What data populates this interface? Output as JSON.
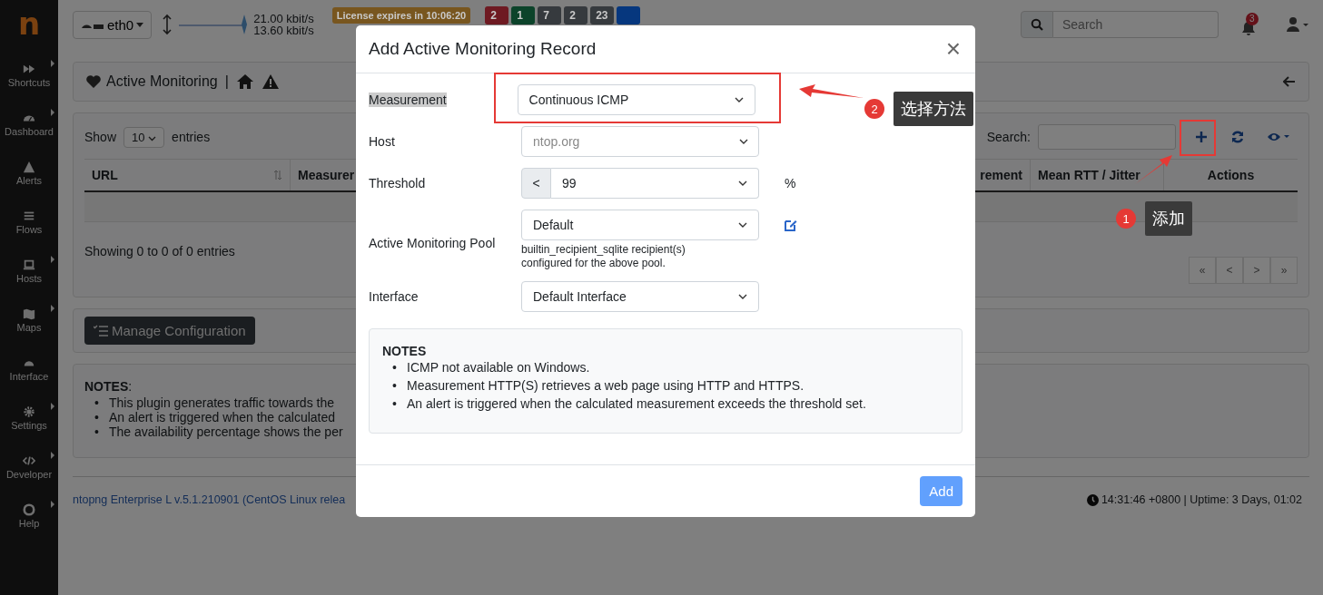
{
  "sidebar": {
    "logo": "n",
    "items": [
      {
        "label": "Shortcuts",
        "submenu": true
      },
      {
        "label": "Dashboard",
        "submenu": true
      },
      {
        "label": "Alerts",
        "submenu": false
      },
      {
        "label": "Flows",
        "submenu": false
      },
      {
        "label": "Hosts",
        "submenu": true
      },
      {
        "label": "Maps",
        "submenu": true
      },
      {
        "label": "Interface",
        "submenu": false
      },
      {
        "label": "Settings",
        "submenu": true
      },
      {
        "label": "Developer",
        "submenu": true
      },
      {
        "label": "Help",
        "submenu": true
      }
    ]
  },
  "topbar": {
    "interface": "eth0",
    "upload": "21.00 kbit/s",
    "download": "13.60 kbit/s",
    "license": "License expires in 10:06:20",
    "badges": [
      {
        "text": "2",
        "color": "#6e1a22"
      },
      {
        "text": "1",
        "color": "#0c432a"
      },
      {
        "text": "7",
        "color": "#363a3e"
      },
      {
        "text": "2",
        "color": "#363a3e"
      },
      {
        "text": "23",
        "color": "#363a3e"
      },
      {
        "color": "#06377e"
      }
    ],
    "search": {
      "placeholder": "Search"
    },
    "notifications": "3"
  },
  "breadcrumb": {
    "title": "Active Monitoring",
    "separator": "|"
  },
  "table": {
    "show": "Show",
    "page_size": "10",
    "entries": "entries",
    "search_label": "Search:",
    "columns": [
      {
        "label": "URL",
        "sortable": true
      },
      {
        "label": "Measurer",
        "sortable": false
      },
      {
        "label": "rement",
        "sortable": false
      },
      {
        "label": "Mean RTT / Jitter",
        "sortable": false
      },
      {
        "label": "Actions",
        "sortable": false
      }
    ],
    "info": "Showing 0 to 0 of 0 entries",
    "pagination": [
      "«",
      "<",
      ">",
      "»"
    ]
  },
  "manage_button": "Manage Configuration",
  "notes": {
    "title": "NOTES",
    "colon": ":",
    "bullet": "•",
    "items": [
      "This plugin generates traffic towards the",
      "An alert is triggered when the calculated",
      "The availability percentage shows the per"
    ]
  },
  "footer": {
    "version": "ntopng Enterprise L v.5.1.210901 (CentOS Linux relea",
    "status": "14:31:46 +0800 | Uptime: 3 Days, 01:02"
  },
  "modal": {
    "title": "Add Active Monitoring Record",
    "close": "×",
    "measurement": {
      "label": "Measurement",
      "highlighted": true,
      "value": "Continuous ICMP"
    },
    "host": {
      "label": "Host",
      "placeholder": "ntop.org"
    },
    "threshold": {
      "label": "Threshold",
      "operator": "<",
      "value": "99",
      "unit": "%"
    },
    "pool": {
      "label": "Active Monitoring Pool",
      "value": "Default",
      "help": "builtin_recipient_sqlite recipient(s) configured for the above pool."
    },
    "interface": {
      "label": "Interface",
      "value": "Default Interface"
    },
    "notes": {
      "title": "NOTES",
      "bullet": "•",
      "items": [
        "ICMP not available on Windows.",
        "Measurement HTTP(S) retrieves a web page using HTTP and HTTPS.",
        "An alert is triggered when the calculated measurement exceeds the threshold set."
      ]
    },
    "add_button": {
      "label": "Add",
      "disabled": true
    }
  },
  "annotations": [
    {
      "number": "2",
      "text": "选择方法"
    },
    {
      "number": "1",
      "text": "添加"
    }
  ]
}
